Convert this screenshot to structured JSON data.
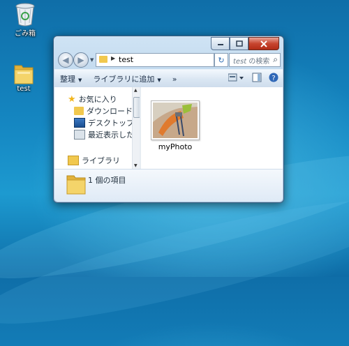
{
  "desktop": {
    "icons": [
      {
        "label": "ごみ箱",
        "icon": "recycle-bin-icon"
      },
      {
        "label": "test",
        "icon": "folder-icon"
      }
    ]
  },
  "window": {
    "address": {
      "path": "test"
    },
    "search": {
      "placeholder_italic": "test",
      "placeholder_rest": " の検索"
    },
    "toolbar": {
      "organize": "整理",
      "add_to_library": "ライブラリに追加",
      "more": "»"
    },
    "nav": {
      "favorites": "お気に入り",
      "downloads": "ダウンロード",
      "desktop": "デスクトップ",
      "recent": "最近表示した場所",
      "libraries": "ライブラリ"
    },
    "files": [
      {
        "name": "myPhoto",
        "type": "image"
      }
    ],
    "details": {
      "count": "1 個の項目"
    }
  },
  "colors": {
    "desktop_bg": "#1587c2",
    "close_button": "#c7452f",
    "folder": "#f1c84e"
  }
}
